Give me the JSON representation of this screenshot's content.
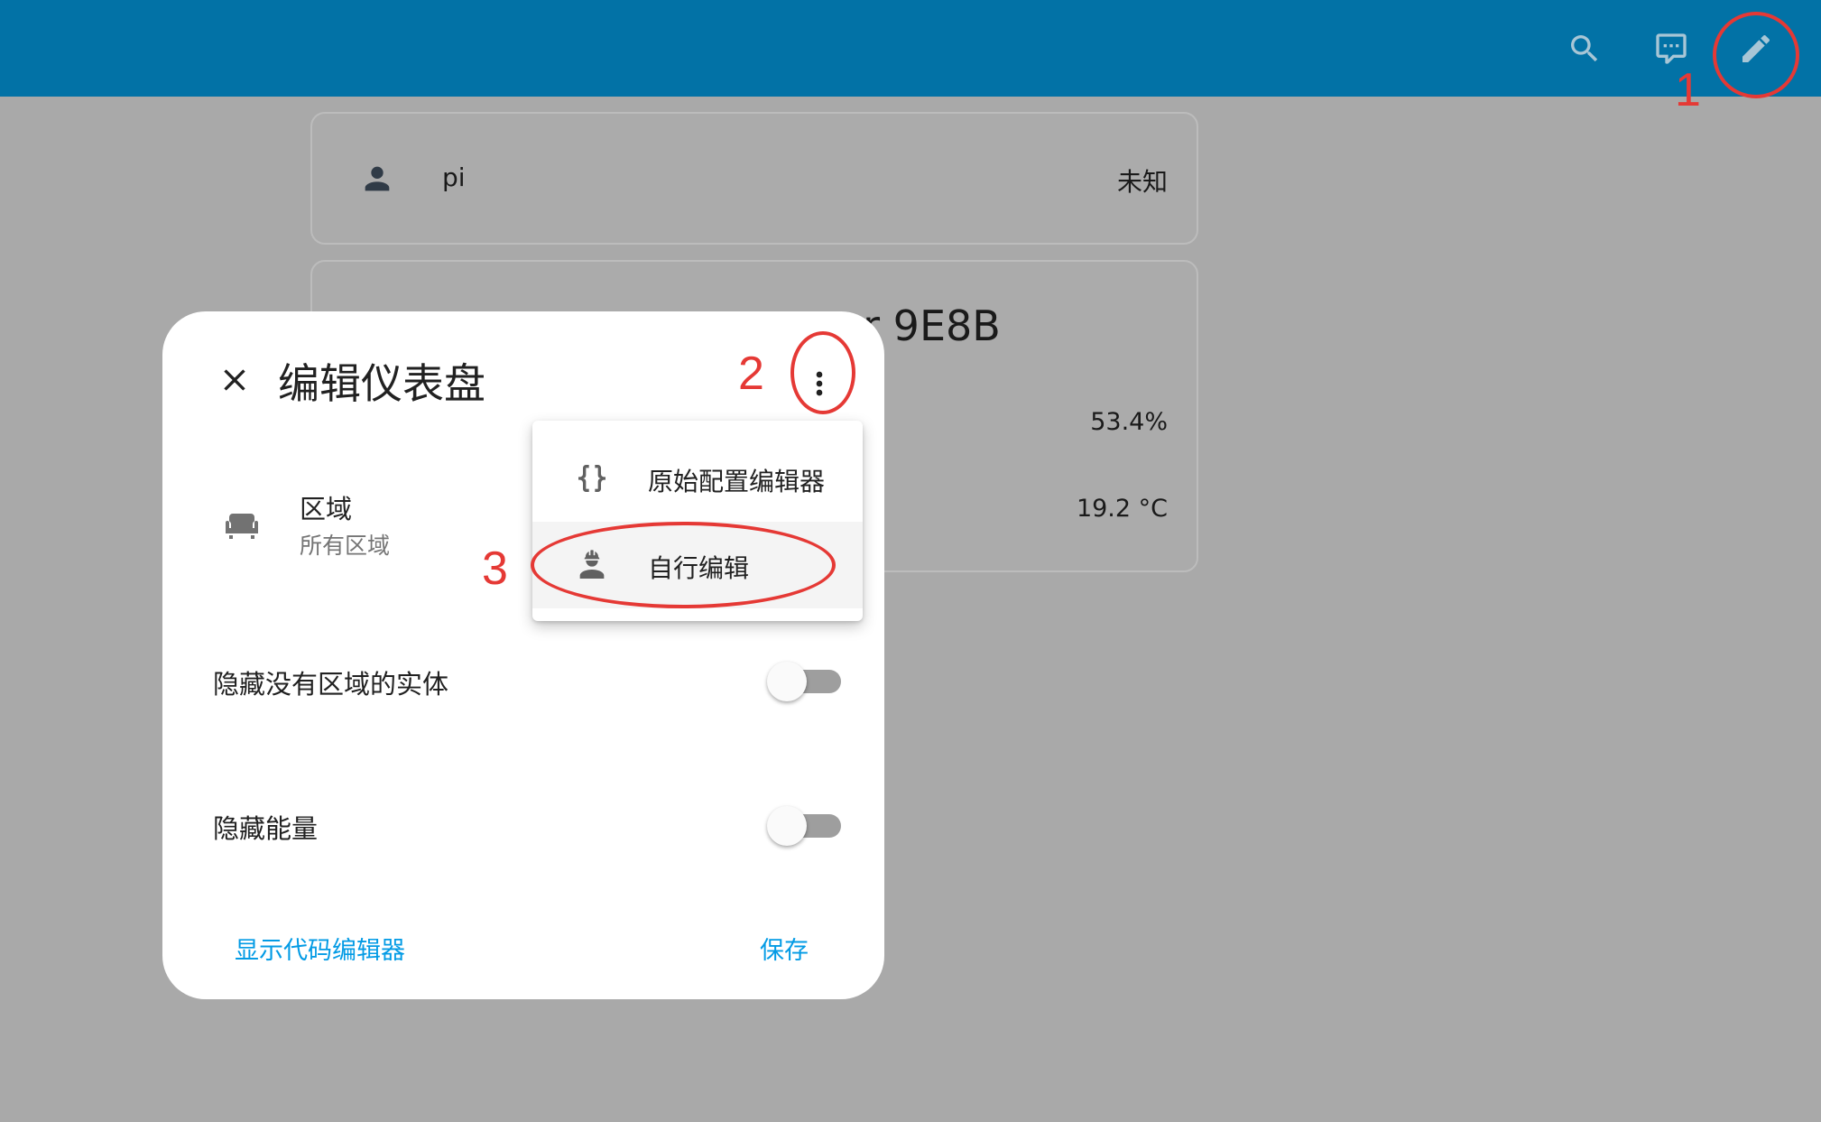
{
  "topbar": {
    "icons": [
      "search-icon",
      "assist-icon",
      "pencil-icon"
    ]
  },
  "cards": {
    "person": {
      "name": "pi",
      "state": "未知"
    },
    "sensor": {
      "title_partial": "or 9E8B",
      "value1": "53.4%",
      "value2": "19.2 °C"
    }
  },
  "dialog": {
    "title": "编辑仪表盘",
    "area": {
      "label": "区域",
      "value": "所有区域"
    },
    "toggles": [
      {
        "label": "隐藏没有区域的实体",
        "on": false
      },
      {
        "label": "隐藏能量",
        "on": false
      }
    ],
    "footer": {
      "code_editor": "显示代码编辑器",
      "save": "保存"
    }
  },
  "menu": {
    "items": [
      {
        "label": "原始配置编辑器",
        "icon": "code-braces-icon"
      },
      {
        "label": "自行编辑",
        "icon": "account-hard-hat-icon"
      }
    ]
  },
  "annotations": {
    "n1": "1",
    "n2": "2",
    "n3": "3",
    "color": "#e53935"
  },
  "colors": {
    "topbar": "#0272a6",
    "accent": "#039be5",
    "overlay": "#a9a9a9"
  }
}
